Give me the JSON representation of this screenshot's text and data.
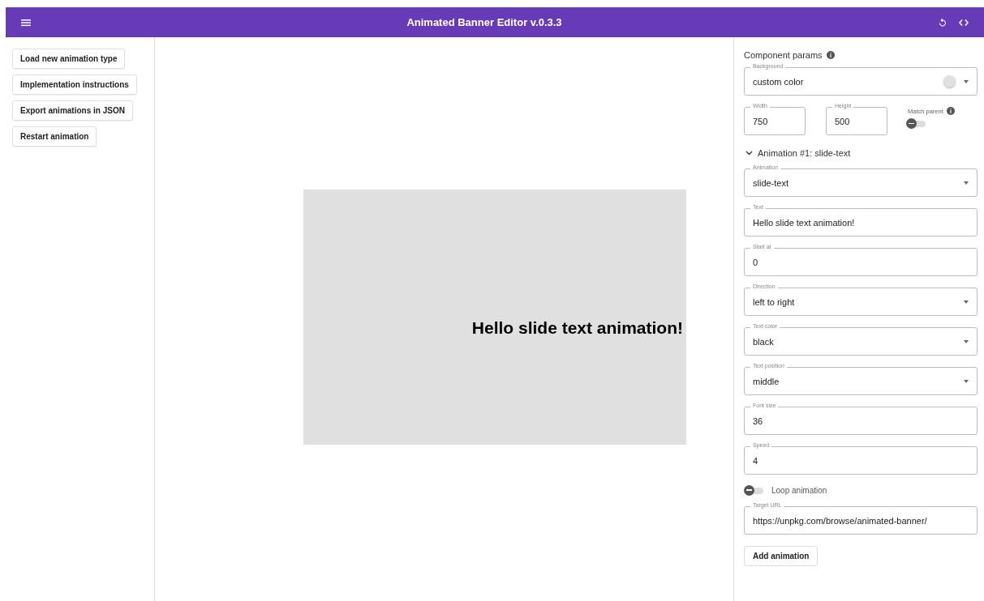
{
  "app_bar": {
    "title": "Animated Banner Editor v.0.3.3"
  },
  "sidebar": {
    "buttons": [
      "Load new animation type",
      "Implementation instructions",
      "Export animations in JSON",
      "Restart animation"
    ]
  },
  "preview": {
    "text": "Hello slide text animation!"
  },
  "params": {
    "title": "Component params",
    "background": {
      "label": "Background",
      "value": "custom color",
      "color": "#e0e0e0"
    },
    "width": {
      "label": "Width",
      "value": "750"
    },
    "height": {
      "label": "Height",
      "value": "500"
    },
    "match_parent": {
      "label": "Match parent",
      "on": false
    },
    "animation": {
      "title": "Animation #1: slide-text",
      "expanded": true,
      "fields": [
        {
          "kind": "select",
          "label": "Animation",
          "value": "slide-text"
        },
        {
          "kind": "text",
          "label": "Text",
          "value": "Hello slide text animation!"
        },
        {
          "kind": "text",
          "label": "Start at",
          "value": "0"
        },
        {
          "kind": "select",
          "label": "Direction",
          "value": "left to right"
        },
        {
          "kind": "select",
          "label": "Text color",
          "value": "black"
        },
        {
          "kind": "select",
          "label": "Text position",
          "value": "middle"
        },
        {
          "kind": "text",
          "label": "Font size",
          "value": "36"
        },
        {
          "kind": "text",
          "label": "Speed",
          "value": "4"
        }
      ],
      "loop": {
        "label": "Loop animation",
        "on": false
      },
      "target_url": {
        "label": "Target URL",
        "value": "https://unpkg.com/browse/animated-banner/"
      }
    },
    "add_button": "Add animation"
  }
}
